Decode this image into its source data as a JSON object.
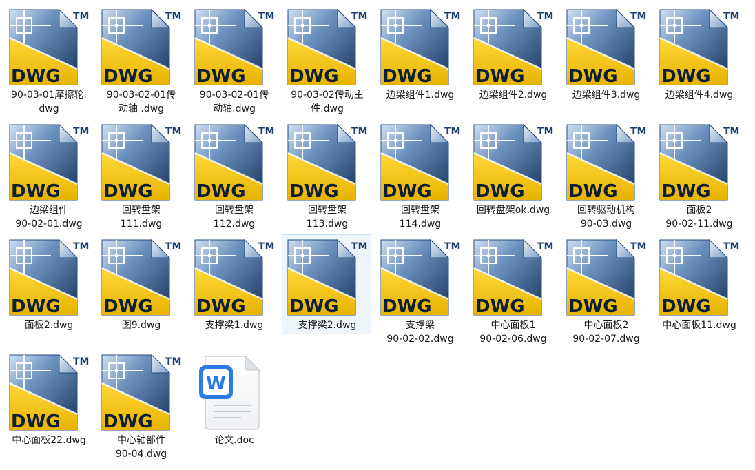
{
  "explorer": {
    "items": [
      {
        "name": "90-03-01摩擦轮.\ndwg",
        "type": "dwg",
        "icon": "dwg-file-icon",
        "badge": "DWG",
        "mark": "TM"
      },
      {
        "name": "90-03-02-01传\n动轴 .dwg",
        "type": "dwg",
        "icon": "dwg-file-icon",
        "badge": "DWG",
        "mark": "TM"
      },
      {
        "name": "90-03-02-01传\n动轴.dwg",
        "type": "dwg",
        "icon": "dwg-file-icon",
        "badge": "DWG",
        "mark": "TM"
      },
      {
        "name": "90-03-02传动主\n件.dwg",
        "type": "dwg",
        "icon": "dwg-file-icon",
        "badge": "DWG",
        "mark": "TM"
      },
      {
        "name": "边梁组件1.dwg",
        "type": "dwg",
        "icon": "dwg-file-icon",
        "badge": "DWG",
        "mark": "TM"
      },
      {
        "name": "边梁组件2.dwg",
        "type": "dwg",
        "icon": "dwg-file-icon",
        "badge": "DWG",
        "mark": "TM"
      },
      {
        "name": "边梁组件3.dwg",
        "type": "dwg",
        "icon": "dwg-file-icon",
        "badge": "DWG",
        "mark": "TM"
      },
      {
        "name": "边梁组件4.dwg",
        "type": "dwg",
        "icon": "dwg-file-icon",
        "badge": "DWG",
        "mark": "TM"
      },
      {
        "name": "边梁组件\n90-02-01.dwg",
        "type": "dwg",
        "icon": "dwg-file-icon",
        "badge": "DWG",
        "mark": "TM"
      },
      {
        "name": "回转盘架\n111.dwg",
        "type": "dwg",
        "icon": "dwg-file-icon",
        "badge": "DWG",
        "mark": "TM"
      },
      {
        "name": "回转盘架\n112.dwg",
        "type": "dwg",
        "icon": "dwg-file-icon",
        "badge": "DWG",
        "mark": "TM"
      },
      {
        "name": "回转盘架\n113.dwg",
        "type": "dwg",
        "icon": "dwg-file-icon",
        "badge": "DWG",
        "mark": "TM"
      },
      {
        "name": "回转盘架\n114.dwg",
        "type": "dwg",
        "icon": "dwg-file-icon",
        "badge": "DWG",
        "mark": "TM"
      },
      {
        "name": "回转盘架ok.dwg",
        "type": "dwg",
        "icon": "dwg-file-icon",
        "badge": "DWG",
        "mark": "TM"
      },
      {
        "name": "回转驱动机构\n90-03.dwg",
        "type": "dwg",
        "icon": "dwg-file-icon",
        "badge": "DWG",
        "mark": "TM"
      },
      {
        "name": "面板2\n90-02-11.dwg",
        "type": "dwg",
        "icon": "dwg-file-icon",
        "badge": "DWG",
        "mark": "TM"
      },
      {
        "name": "面板2.dwg",
        "type": "dwg",
        "icon": "dwg-file-icon",
        "badge": "DWG",
        "mark": "TM"
      },
      {
        "name": "图9.dwg",
        "type": "dwg",
        "icon": "dwg-file-icon",
        "badge": "DWG",
        "mark": "TM"
      },
      {
        "name": "支撑梁1.dwg",
        "type": "dwg",
        "icon": "dwg-file-icon",
        "badge": "DWG",
        "mark": "TM"
      },
      {
        "name": "支撑梁2.dwg",
        "type": "dwg",
        "icon": "dwg-file-icon",
        "badge": "DWG",
        "mark": "TM",
        "selected": true
      },
      {
        "name": "支撑梁\n90-02-02.dwg",
        "type": "dwg",
        "icon": "dwg-file-icon",
        "badge": "DWG",
        "mark": "TM"
      },
      {
        "name": "中心面板1\n90-02-06.dwg",
        "type": "dwg",
        "icon": "dwg-file-icon",
        "badge": "DWG",
        "mark": "TM"
      },
      {
        "name": "中心面板2\n90-02-07.dwg",
        "type": "dwg",
        "icon": "dwg-file-icon",
        "badge": "DWG",
        "mark": "TM"
      },
      {
        "name": "中心面板11.dwg",
        "type": "dwg",
        "icon": "dwg-file-icon",
        "badge": "DWG",
        "mark": "TM"
      },
      {
        "name": "中心面板22.dwg",
        "type": "dwg",
        "icon": "dwg-file-icon",
        "badge": "DWG",
        "mark": "TM"
      },
      {
        "name": "中心轴部件\n90-04.dwg",
        "type": "dwg",
        "icon": "dwg-file-icon",
        "badge": "DWG",
        "mark": "TM"
      },
      {
        "name": "论文.doc",
        "type": "doc",
        "icon": "word-doc-icon",
        "badge": "W"
      }
    ]
  },
  "colors": {
    "dwg_blue_dark": "#1c3f6e",
    "dwg_blue_light": "#8fb0d6",
    "dwg_yellow": "#f5c400",
    "dwg_text": "#0d1f36",
    "word_blue": "#2b7be4",
    "selection_bg": "#eef5fd",
    "selection_border": "#c9dff6"
  }
}
